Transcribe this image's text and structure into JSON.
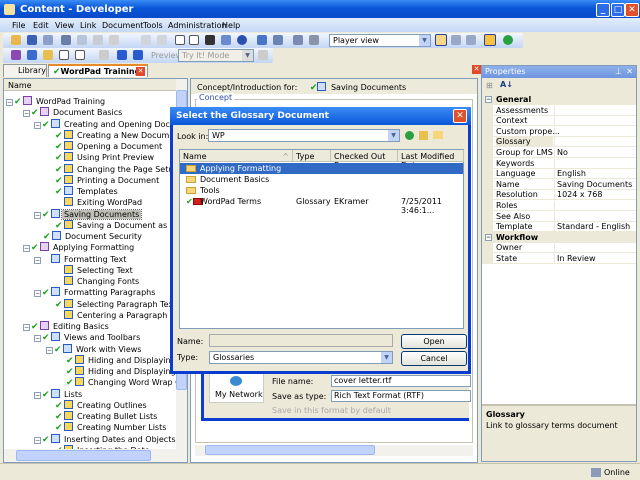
{
  "window": {
    "title": "Content - Developer",
    "min": "_",
    "max": "□",
    "close": "✕"
  },
  "menu": [
    "File",
    "Edit",
    "View",
    "Link",
    "Document",
    "Tools",
    "Administration",
    "Help"
  ],
  "toolbar": {
    "view_select": "Player view",
    "preview_label": "Preview:",
    "preview_select": "Try It! Mode"
  },
  "tabs": {
    "library": "Library",
    "active": "WordPad Training"
  },
  "tree": {
    "header": "Name",
    "items": [
      {
        "l": 0,
        "t": "WordPad Training",
        "i": "bk",
        "c": 1,
        "e": 1
      },
      {
        "l": 1,
        "t": "Document Basics",
        "i": "bk",
        "c": 1,
        "e": 1
      },
      {
        "l": 2,
        "t": "Creating and Opening Documents",
        "i": "mod",
        "c": 1,
        "e": 1
      },
      {
        "l": 3,
        "t": "Creating a New Document",
        "i": "top",
        "c": 1
      },
      {
        "l": 3,
        "t": "Opening a Document",
        "i": "top",
        "c": 1
      },
      {
        "l": 3,
        "t": "Using Print Preview",
        "i": "top",
        "c": 1
      },
      {
        "l": 3,
        "t": "Changing the Page Setup",
        "i": "top",
        "c": 1
      },
      {
        "l": 3,
        "t": "Printing a Document",
        "i": "top",
        "c": 1
      },
      {
        "l": 3,
        "t": "Templates",
        "i": "mod",
        "c": 1
      },
      {
        "l": 3,
        "t": "Exiting WordPad",
        "i": "top",
        "c": 0
      },
      {
        "l": 2,
        "t": "Saving Documents",
        "i": "mod",
        "c": 1,
        "e": 1,
        "s": 1
      },
      {
        "l": 3,
        "t": "Saving a Document as a New File",
        "i": "top",
        "c": 1
      },
      {
        "l": 2,
        "t": "Document Security",
        "i": "mod",
        "c": 1
      },
      {
        "l": 1,
        "t": "Applying Formatting",
        "i": "bk",
        "c": 1,
        "e": 1
      },
      {
        "l": 2,
        "t": "Formatting Text",
        "i": "mod",
        "c": 0,
        "e": 1
      },
      {
        "l": 3,
        "t": "Selecting Text",
        "i": "top",
        "c": 0
      },
      {
        "l": 3,
        "t": "Changing Fonts",
        "i": "top",
        "c": 0
      },
      {
        "l": 2,
        "t": "Formatting Paragraphs",
        "i": "mod",
        "c": 1,
        "e": 1
      },
      {
        "l": 3,
        "t": "Selecting Paragraph Text",
        "i": "top",
        "c": 1
      },
      {
        "l": 3,
        "t": "Centering a Paragraph",
        "i": "top",
        "c": 0
      },
      {
        "l": 1,
        "t": "Editing Basics",
        "i": "bk",
        "c": 1,
        "e": 1
      },
      {
        "l": 2,
        "t": "Views and Toolbars",
        "i": "mod",
        "c": 1,
        "e": 1
      },
      {
        "l": 3,
        "t": "Work with Views",
        "i": "mod",
        "c": 1,
        "e": 1
      },
      {
        "l": 4,
        "t": "Hiding and Displaying the Ruler",
        "i": "top",
        "c": 1
      },
      {
        "l": 4,
        "t": "Hiding and Displaying the Status Bar",
        "i": "top",
        "c": 1
      },
      {
        "l": 4,
        "t": "Changing Word Wrap Options",
        "i": "top",
        "c": 1
      },
      {
        "l": 2,
        "t": "Lists",
        "i": "mod",
        "c": 1,
        "e": 1
      },
      {
        "l": 3,
        "t": "Creating Outlines",
        "i": "top",
        "c": 1
      },
      {
        "l": 3,
        "t": "Creating Bullet Lists",
        "i": "top",
        "c": 1
      },
      {
        "l": 3,
        "t": "Creating Number Lists",
        "i": "top",
        "c": 1
      },
      {
        "l": 2,
        "t": "Inserting Dates and Objects",
        "i": "mod",
        "c": 1,
        "e": 1
      },
      {
        "l": 3,
        "t": "Inserting the Date",
        "i": "top",
        "c": 1
      }
    ]
  },
  "middle": {
    "header": "Concept/Introduction for:",
    "doc": "Saving Documents",
    "concept": "Concept",
    "bg_file_name_label": "File name:",
    "bg_file_name": "cover letter.rtf",
    "bg_save_type_label": "Save as type:",
    "bg_save_type": "Rich Text Format (RTF)",
    "bg_default": "Save in this format by default",
    "bg_network": "My Network"
  },
  "dialog": {
    "title": "Select the Glossary Document",
    "look_in_label": "Look in:",
    "look_in": "WP",
    "columns": [
      "Name",
      "Type",
      "Checked Out By",
      "Last Modified Date"
    ],
    "rows": [
      {
        "name": "Applying Formatting",
        "type": "",
        "by": "",
        "date": ""
      },
      {
        "name": "Document Basics",
        "type": "",
        "by": "",
        "date": ""
      },
      {
        "name": "Tools",
        "type": "",
        "by": "",
        "date": ""
      },
      {
        "name": "WordPad Terms",
        "type": "Glossary",
        "by": "EKramer",
        "date": "7/25/2011 3:46:1..."
      }
    ],
    "name_label": "Name:",
    "name_value": "",
    "type_label": "Type:",
    "type_value": "Glossaries",
    "open": "Open",
    "cancel": "Cancel"
  },
  "properties": {
    "title": "Properties",
    "rows": [
      {
        "cat": "General"
      },
      {
        "k": "Assessments",
        "v": ""
      },
      {
        "k": "Context",
        "v": ""
      },
      {
        "k": "Custom prope...",
        "v": ""
      },
      {
        "k": "Glossary",
        "v": "",
        "sel": 1
      },
      {
        "k": "Group for LMS",
        "v": "No"
      },
      {
        "k": "Keywords",
        "v": ""
      },
      {
        "k": "Language",
        "v": "English"
      },
      {
        "k": "Name",
        "v": "Saving Documents"
      },
      {
        "k": "Resolution",
        "v": "1024 x 768"
      },
      {
        "k": "Roles",
        "v": ""
      },
      {
        "k": "See Also",
        "v": ""
      },
      {
        "k": "Template",
        "v": "Standard - English"
      },
      {
        "cat": "Workflow"
      },
      {
        "k": "Owner",
        "v": ""
      },
      {
        "k": "State",
        "v": "In Review"
      }
    ],
    "desc_title": "Glossary",
    "desc_text": "Link to glossary terms document"
  },
  "status": {
    "online": "Online"
  }
}
